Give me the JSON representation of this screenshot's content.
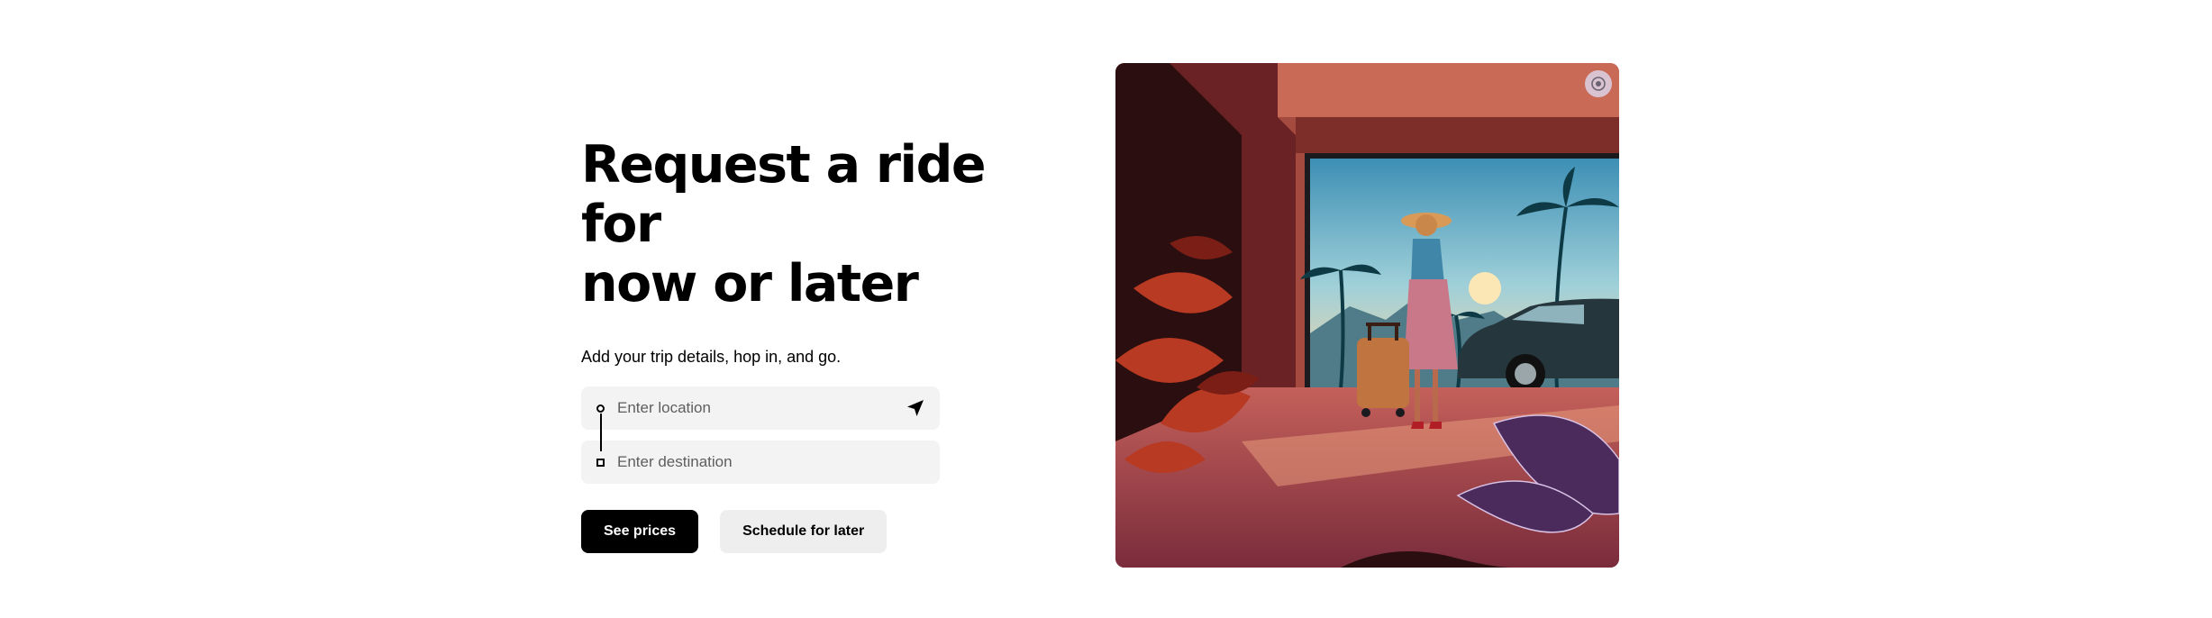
{
  "hero": {
    "title_line1": "Request a ride for",
    "title_line2": "now or later",
    "subtitle": "Add your trip details, hop in, and go."
  },
  "form": {
    "pickup_placeholder": "Enter location",
    "pickup_value": "",
    "destination_placeholder": "Enter destination",
    "destination_value": "",
    "pickup_icon": "navigation-arrow-icon"
  },
  "actions": {
    "primary_label": "See prices",
    "secondary_label": "Schedule for later"
  },
  "illustration": {
    "subject": "traveler with suitcase beside car under palm trees",
    "badge_icon": "camera-lens-icon"
  },
  "colors": {
    "primary_button": "#000000",
    "secondary_button": "#eeeeee",
    "field_background": "#f3f3f3"
  }
}
